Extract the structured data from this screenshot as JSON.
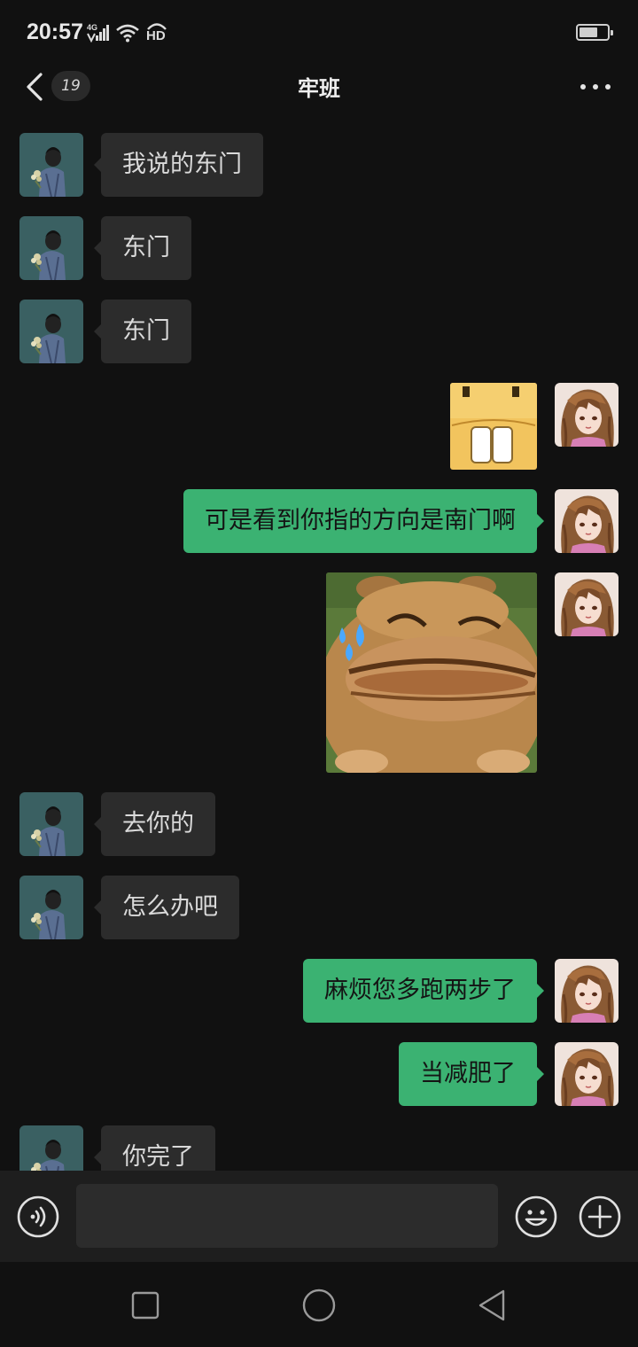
{
  "status_bar": {
    "time": "20:57",
    "network": "4G",
    "hd": "HD"
  },
  "header": {
    "unread_count": "19",
    "title": "牢班"
  },
  "messages": [
    {
      "side": "left",
      "type": "text",
      "text": "我说的东门"
    },
    {
      "side": "left",
      "type": "text",
      "text": "东门"
    },
    {
      "side": "left",
      "type": "text",
      "text": "东门"
    },
    {
      "side": "right",
      "type": "sticker",
      "sticker": "buck-teeth-sticker"
    },
    {
      "side": "right",
      "type": "text",
      "text": "可是看到你指的方向是南门啊"
    },
    {
      "side": "right",
      "type": "sticker",
      "sticker": "crying-bear-sticker"
    },
    {
      "side": "left",
      "type": "text",
      "text": "去你的"
    },
    {
      "side": "left",
      "type": "text",
      "text": "怎么办吧"
    },
    {
      "side": "right",
      "type": "text",
      "text": "麻烦您多跑两步了"
    },
    {
      "side": "right",
      "type": "text",
      "text": "当减肥了"
    },
    {
      "side": "left",
      "type": "text",
      "text": "你完了"
    }
  ],
  "input": {
    "value": "",
    "placeholder": ""
  },
  "colors": {
    "background": "#111111",
    "incoming_bubble": "#2c2c2c",
    "outgoing_bubble": "#3bb272",
    "input_bar": "#1e1e1e"
  },
  "icons": [
    "back-arrow-icon",
    "more-dots-icon",
    "voice-icon",
    "emoji-icon",
    "plus-icon",
    "nav-recents-icon",
    "nav-home-icon",
    "nav-back-icon"
  ]
}
